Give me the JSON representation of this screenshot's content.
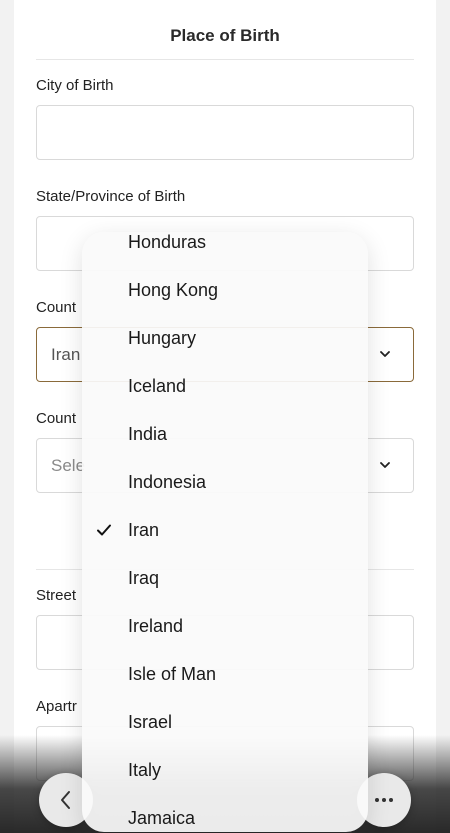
{
  "form": {
    "section_title": "Place of Birth",
    "city_label": "City of Birth",
    "city_value": "",
    "state_label": "State/Province of Birth",
    "state_value": "",
    "country_label": "Count",
    "country_value": "Iran",
    "country2_label": "Count",
    "country2_placeholder": "Sele",
    "street_label": "Street",
    "apartment_label": "Apartr"
  },
  "dropdown": {
    "selected": "Iran",
    "options": [
      "Honduras",
      "Hong Kong",
      "Hungary",
      "Iceland",
      "India",
      "Indonesia",
      "Iran",
      "Iraq",
      "Ireland",
      "Isle of Man",
      "Israel",
      "Italy",
      "Jamaica"
    ]
  },
  "toolbar": {
    "back_icon": "chevron-left-icon",
    "more_icon": "more-horizontal-icon"
  }
}
